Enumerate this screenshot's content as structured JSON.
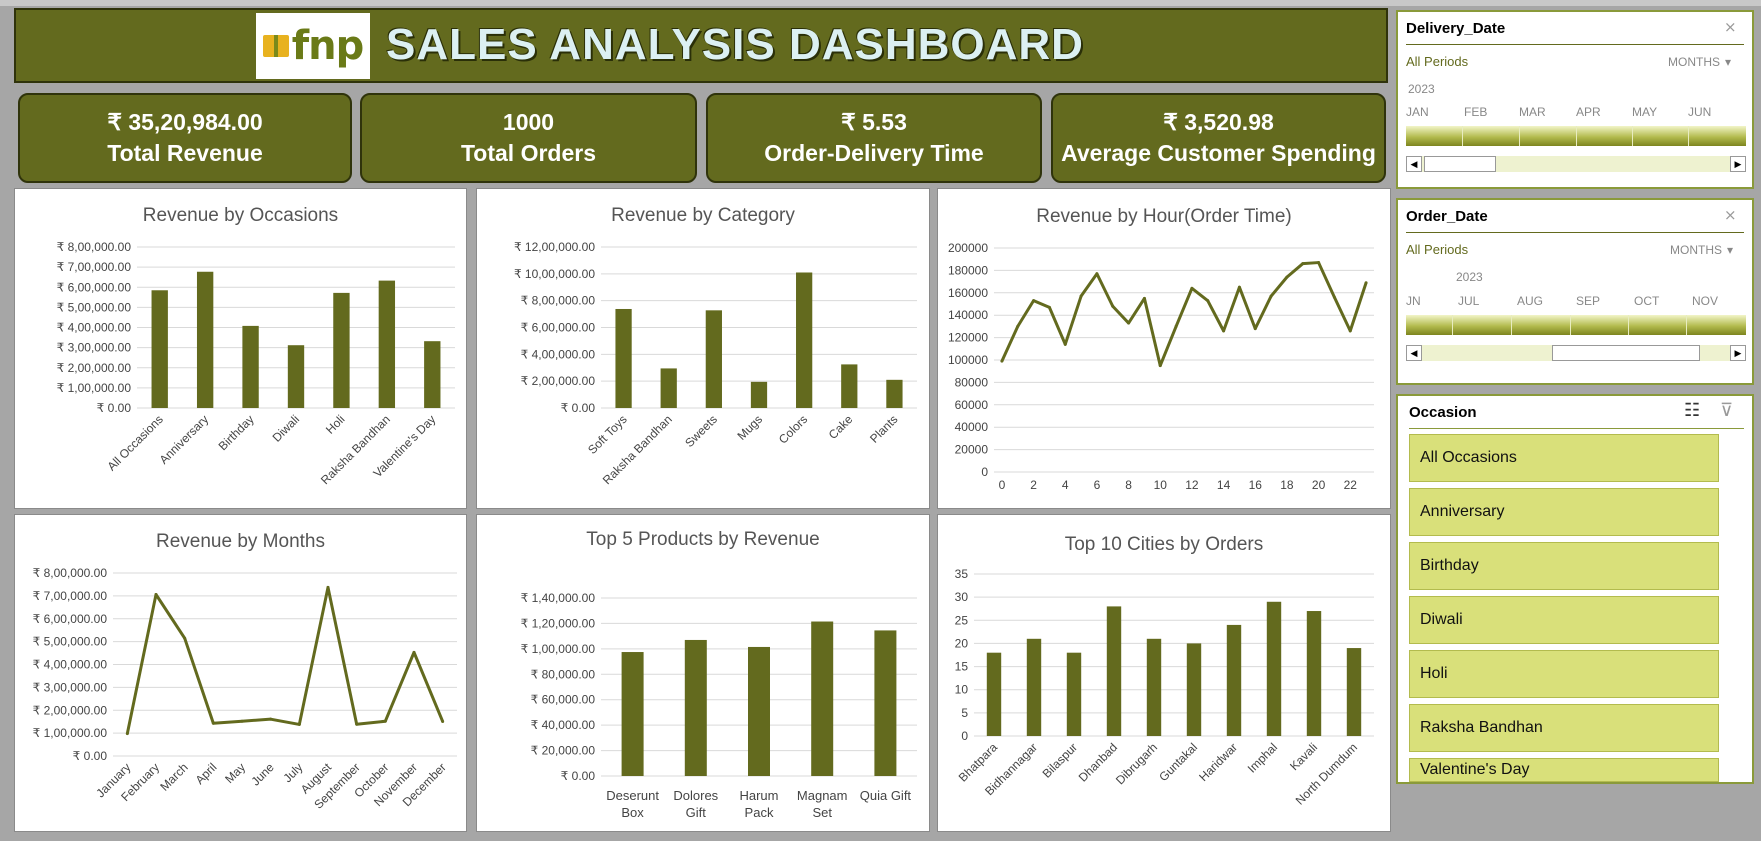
{
  "header": {
    "logo_text": "fnp",
    "title": "SALES ANALYSIS DASHBOARD"
  },
  "kpis": [
    {
      "value": "₹ 35,20,984.00",
      "label": "Total Revenue"
    },
    {
      "value": "1000",
      "label": "Total Orders"
    },
    {
      "value": "₹ 5.53",
      "label": "Order-Delivery Time"
    },
    {
      "value": "₹ 3,520.98",
      "label": "Average Customer Spending"
    }
  ],
  "delivery_slicer": {
    "title": "Delivery_Date",
    "period": "All Periods",
    "unit": "MONTHS",
    "year": "2023",
    "months": [
      "JAN",
      "FEB",
      "MAR",
      "APR",
      "MAY",
      "JUN"
    ]
  },
  "order_slicer": {
    "title": "Order_Date",
    "period": "All Periods",
    "unit": "MONTHS",
    "year": "2023",
    "months": [
      "JN",
      "JUL",
      "AUG",
      "SEP",
      "OCT",
      "NOV"
    ]
  },
  "occasion_slicer": {
    "title": "Occasion",
    "items": [
      "All Occasions",
      "Anniversary",
      "Birthday",
      "Diwali",
      "Holi",
      "Raksha Bandhan",
      "Valentine's Day"
    ]
  },
  "colors": {
    "accent": "#636a1e",
    "bar": "#636a1e",
    "slicer_item": "#d9e07a",
    "header_text": "#dcf0f2"
  },
  "chart_data": [
    {
      "id": "occasions",
      "type": "bar",
      "title": "Revenue by Occasions",
      "categories": [
        "All Occasions",
        "Anniversary",
        "Birthday",
        "Diwali",
        "Holi",
        "Raksha Bandhan",
        "Valentine's Day"
      ],
      "values": [
        585000,
        677000,
        408000,
        312000,
        572000,
        633000,
        332000
      ],
      "yticks": [
        "₹ 0.00",
        "₹ 1,00,000.00",
        "₹ 2,00,000.00",
        "₹ 3,00,000.00",
        "₹ 4,00,000.00",
        "₹ 5,00,000.00",
        "₹ 6,00,000.00",
        "₹ 7,00,000.00",
        "₹ 8,00,000.00"
      ],
      "ylim": [
        0,
        800000
      ]
    },
    {
      "id": "category",
      "type": "bar",
      "title": "Revenue by Category",
      "categories": [
        "Soft Toys",
        "Raksha Bandhan",
        "Sweets",
        "Mugs",
        "Colors",
        "Cake",
        "Plants"
      ],
      "values": [
        738000,
        295000,
        728000,
        195000,
        1010000,
        325000,
        210000
      ],
      "yticks": [
        "₹ 0.00",
        "₹ 2,00,000.00",
        "₹ 4,00,000.00",
        "₹ 6,00,000.00",
        "₹ 8,00,000.00",
        "₹ 10,00,000.00",
        "₹ 12,00,000.00"
      ],
      "ylim": [
        0,
        1200000
      ]
    },
    {
      "id": "hour",
      "type": "line",
      "title": "Revenue by Hour(Order Time)",
      "x": [
        0,
        1,
        2,
        3,
        4,
        5,
        6,
        7,
        8,
        9,
        10,
        11,
        12,
        13,
        14,
        15,
        16,
        17,
        18,
        19,
        20,
        21,
        22,
        23
      ],
      "values": [
        99000,
        130000,
        153000,
        147000,
        114000,
        157000,
        177000,
        148000,
        133000,
        155000,
        95000,
        130000,
        164000,
        153000,
        126000,
        165000,
        128000,
        157000,
        174000,
        186000,
        187000,
        156000,
        126000,
        169000
      ],
      "xticks": [
        "0",
        "2",
        "4",
        "6",
        "8",
        "10",
        "12",
        "14",
        "16",
        "18",
        "20",
        "22"
      ],
      "yticks": [
        "0",
        "20000",
        "40000",
        "60000",
        "80000",
        "100000",
        "120000",
        "140000",
        "160000",
        "180000",
        "200000"
      ],
      "ylim": [
        0,
        200000
      ]
    },
    {
      "id": "months",
      "type": "line",
      "title": "Revenue by Months",
      "categories": [
        "January",
        "February",
        "March",
        "April",
        "May",
        "June",
        "July",
        "August",
        "September",
        "October",
        "November",
        "December"
      ],
      "values": [
        98000,
        706000,
        515000,
        143000,
        152000,
        161000,
        138000,
        737000,
        139000,
        152000,
        453000,
        151000
      ],
      "yticks": [
        "₹ 0.00",
        "₹ 1,00,000.00",
        "₹ 2,00,000.00",
        "₹ 3,00,000.00",
        "₹ 4,00,000.00",
        "₹ 5,00,000.00",
        "₹ 6,00,000.00",
        "₹ 7,00,000.00",
        "₹ 8,00,000.00"
      ],
      "ylim": [
        0,
        800000
      ]
    },
    {
      "id": "products",
      "type": "bar",
      "title": "Top 5 Products by Revenue",
      "categories": [
        "Deserunt Box",
        "Dolores Gift",
        "Harum Pack",
        "Magnam Set",
        "Quia Gift"
      ],
      "category_lines": [
        [
          "Deserunt",
          "Box"
        ],
        [
          "Dolores",
          "Gift"
        ],
        [
          "Harum",
          "Pack"
        ],
        [
          "Magnam",
          "Set"
        ],
        [
          "Quia Gift"
        ]
      ],
      "values": [
        97500,
        107000,
        101500,
        121500,
        114500
      ],
      "yticks": [
        "₹ 0.00",
        "₹ 20,000.00",
        "₹ 40,000.00",
        "₹ 60,000.00",
        "₹ 80,000.00",
        "₹ 1,00,000.00",
        "₹ 1,20,000.00",
        "₹ 1,40,000.00"
      ],
      "ylim": [
        0,
        140000
      ]
    },
    {
      "id": "cities",
      "type": "bar",
      "title": "Top 10 Cities by Orders",
      "categories": [
        "Bhatpara",
        "Bidhannagar",
        "Bilaspur",
        "Dhanbad",
        "Dibrugarh",
        "Guntakal",
        "Haridwar",
        "Imphal",
        "Kavali",
        "North Dumdum"
      ],
      "values": [
        18,
        21,
        18,
        28,
        21,
        20,
        24,
        29,
        27,
        19
      ],
      "yticks": [
        "0",
        "5",
        "10",
        "15",
        "20",
        "25",
        "30",
        "35"
      ],
      "ylim": [
        0,
        35
      ]
    }
  ]
}
